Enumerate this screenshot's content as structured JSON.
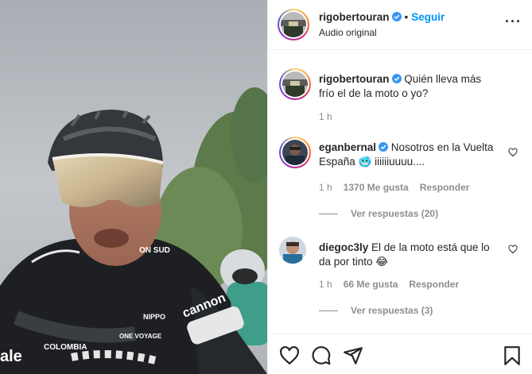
{
  "post": {
    "author": "rigobertouran",
    "follow_label": "Seguir",
    "dot": "•",
    "audio": "Audio original",
    "more": "···"
  },
  "caption": {
    "author": "rigobertouran",
    "text": "Quién lleva más frío el de la moto o yo?",
    "time": "1 h"
  },
  "comments": [
    {
      "author": "eganbernal",
      "text": "Nosotros en la Vuelta España 🥶 iiiiiiuuuu....",
      "time": "1 h",
      "likes": "1370 Me gusta",
      "reply": "Responder",
      "view_replies": "Ver respuestas (20)"
    },
    {
      "author": "diegoc3ly",
      "text": "El de la moto está que lo da por tinto 😂",
      "time": "1 h",
      "likes": "66 Me gusta",
      "reply": "Responder",
      "view_replies": "Ver respuestas (3)"
    }
  ],
  "media": {
    "jersey_texts": [
      "ON SUD",
      "NIPPO",
      "cannon",
      "COLOMBIA",
      "ale",
      "ONE VOYAGE"
    ]
  },
  "icons": [
    "heart-icon",
    "comment-icon",
    "share-icon",
    "bookmark-icon",
    "verified-icon",
    "more-icon"
  ],
  "colors": {
    "link": "#0095f6",
    "verified": "#3897f0",
    "meta": "#8e8e8e"
  }
}
